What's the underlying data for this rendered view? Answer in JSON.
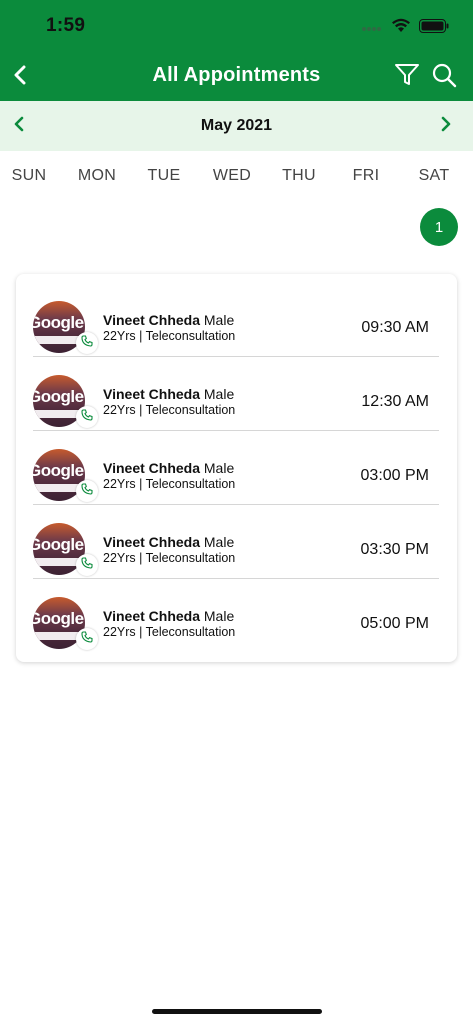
{
  "status_bar": {
    "time": "1:59"
  },
  "header": {
    "title": "All Appointments"
  },
  "calendar": {
    "month_label": "May 2021",
    "weekdays": [
      "SUN",
      "MON",
      "TUE",
      "WED",
      "THU",
      "FRI",
      "SAT"
    ],
    "selected_day": "1"
  },
  "appointments": [
    {
      "name": "Vineet Chheda",
      "gender": "Male",
      "details": "22Yrs | Teleconsultation",
      "time": "09:30 AM",
      "avatar_text": "Google"
    },
    {
      "name": "Vineet Chheda",
      "gender": "Male",
      "details": "22Yrs | Teleconsultation",
      "time": "12:30 AM",
      "avatar_text": "Google"
    },
    {
      "name": "Vineet Chheda",
      "gender": "Male",
      "details": "22Yrs | Teleconsultation",
      "time": "03:00 PM",
      "avatar_text": "Google"
    },
    {
      "name": "Vineet Chheda",
      "gender": "Male",
      "details": "22Yrs | Teleconsultation",
      "time": "03:30 PM",
      "avatar_text": "Google"
    },
    {
      "name": "Vineet Chheda",
      "gender": "Male",
      "details": "22Yrs | Teleconsultation",
      "time": "05:00 PM",
      "avatar_text": "Google"
    }
  ],
  "icons": {
    "back": "chevron-left-icon",
    "filter": "filter-icon",
    "search": "search-icon",
    "prev_month": "chevron-left-icon",
    "next_month": "chevron-right-icon",
    "call": "phone-icon"
  },
  "colors": {
    "primary": "#0b8b3c",
    "month_bar": "#e7f5e9"
  }
}
